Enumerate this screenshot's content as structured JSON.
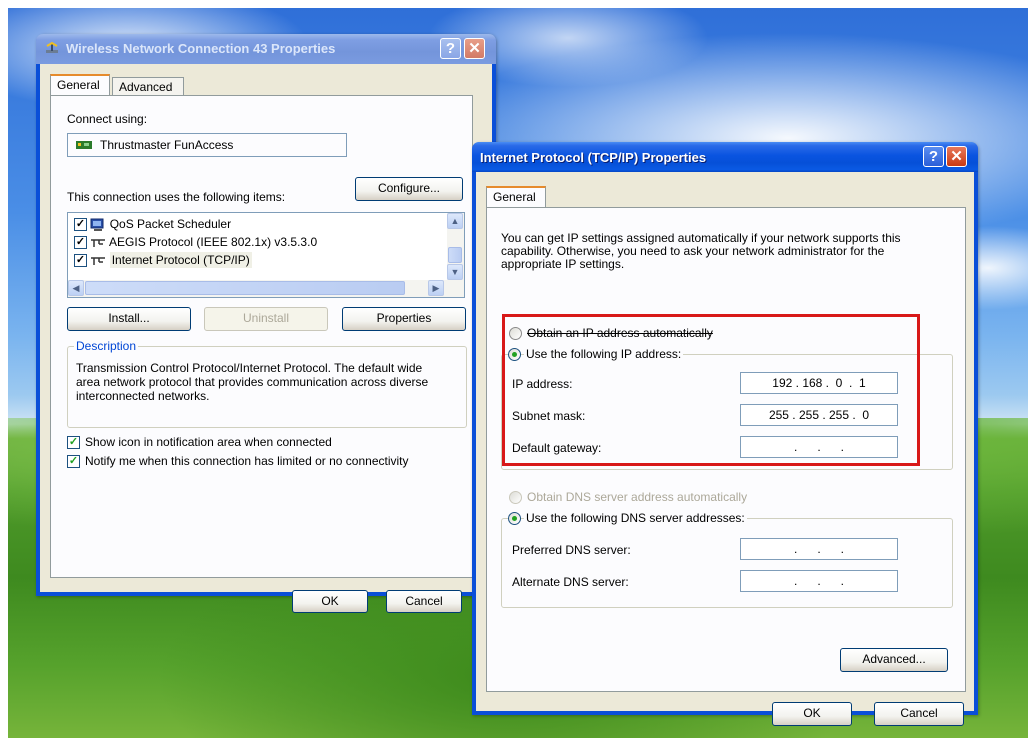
{
  "win1": {
    "title": "Wireless Network Connection 43 Properties",
    "tabs": [
      "General",
      "Advanced"
    ],
    "connect_using_label": "Connect using:",
    "adapter_name": "Thrustmaster FunAccess",
    "configure_button": "Configure...",
    "items_label": "This connection uses the following items:",
    "items": [
      {
        "label": "QoS Packet Scheduler",
        "checked": true
      },
      {
        "label": "AEGIS Protocol (IEEE 802.1x) v3.5.3.0",
        "checked": true
      },
      {
        "label": "Internet Protocol (TCP/IP)",
        "checked": true
      }
    ],
    "install_button": "Install...",
    "uninstall_button": "Uninstall",
    "properties_button": "Properties",
    "description_legend": "Description",
    "description_text": "Transmission Control Protocol/Internet Protocol. The default wide area network protocol that provides communication across diverse interconnected networks.",
    "show_icon_label": "Show icon in notification area when connected",
    "notify_label": "Notify me when this connection has limited or no connectivity",
    "ok_button": "OK",
    "cancel_button": "Cancel"
  },
  "win2": {
    "title": "Internet Protocol (TCP/IP) Properties",
    "tabs": [
      "General"
    ],
    "intro": "You can get IP settings assigned automatically if your network supports this capability. Otherwise, you need to ask your network administrator for the appropriate IP settings.",
    "obtain_ip_label": "Obtain an IP address automatically",
    "use_ip_label": "Use the following IP address:",
    "ip_address_label": "IP address:",
    "ip_address_value": "192 . 168 .  0  .  1",
    "subnet_label": "Subnet mask:",
    "subnet_value": "255 . 255 . 255 .  0",
    "gateway_label": "Default gateway:",
    "gateway_value": " .      .      . ",
    "obtain_dns_label": "Obtain DNS server address automatically",
    "use_dns_label": "Use the following DNS server addresses:",
    "preferred_dns_label": "Preferred DNS server:",
    "preferred_dns_value": " .      .      . ",
    "alternate_dns_label": "Alternate DNS server:",
    "alternate_dns_value": " .      .      . ",
    "advanced_button": "Advanced...",
    "ok_button": "OK",
    "cancel_button": "Cancel"
  },
  "colors": {
    "titlebar_active": "#0a54e0",
    "dialog_bg": "#ece9d8",
    "highlight_box": "#d81818",
    "radio_dot": "#21a121"
  },
  "icons": [
    "network-connection-icon",
    "network-adapter-icon",
    "scheduler-icon",
    "protocol-icon",
    "help-icon",
    "close-icon"
  ]
}
